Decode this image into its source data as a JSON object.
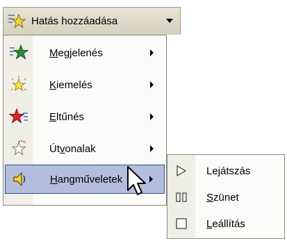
{
  "top_button": {
    "label": "Hatás hozzáadása",
    "icon": "star-add-icon"
  },
  "menu": {
    "items": [
      {
        "pre": "",
        "accel": "M",
        "post": "egjelenés",
        "icon": "entrance-star-icon"
      },
      {
        "pre": "",
        "accel": "K",
        "post": "iemelés",
        "icon": "emphasis-star-icon"
      },
      {
        "pre": "",
        "accel": "E",
        "post": "ltűnés",
        "icon": "exit-star-icon"
      },
      {
        "pre": "Út",
        "accel": "v",
        "post": "onalak",
        "icon": "motion-path-star-icon"
      },
      {
        "pre": "",
        "accel": "H",
        "post": "angműveletek",
        "icon": "sound-speaker-icon"
      }
    ]
  },
  "submenu": {
    "items": [
      {
        "pre": "Le",
        "accel": "j",
        "post": "átszás",
        "icon": "play-icon"
      },
      {
        "pre": "",
        "accel": "S",
        "post": "zünet",
        "icon": "pause-icon"
      },
      {
        "pre": "",
        "accel": "L",
        "post": "eállítás",
        "icon": "stop-icon"
      }
    ]
  },
  "colors": {
    "highlight": "#b3bedc",
    "highlight_border": "#2f4c8f"
  }
}
